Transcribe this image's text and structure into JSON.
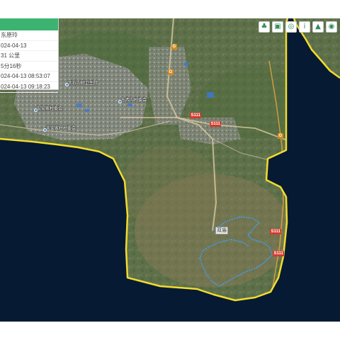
{
  "colors": {
    "background": "#071a33",
    "boundary": "#f2dc2e",
    "track": "#3fa0ff",
    "panel_header": "#3cb371",
    "road_red": "#d23b2c",
    "road_orange": "#d48a1e"
  },
  "info_panel": {
    "rows": [
      "东原玲",
      "024-04-13",
      "31 公里",
      "5分16秒",
      "024-04-13 08:53:07",
      "024-04-13 09:18:23"
    ]
  },
  "toolbar": {
    "buttons": [
      {
        "name": "tree-icon",
        "glyph": "♣"
      },
      {
        "name": "image-icon",
        "glyph": "▣"
      },
      {
        "name": "layers-icon",
        "glyph": "◎"
      },
      {
        "name": "info-icon",
        "glyph": "i"
      },
      {
        "name": "terrain-icon",
        "glyph": "▲"
      },
      {
        "name": "target-icon",
        "glyph": "◉"
      }
    ]
  },
  "map": {
    "road_labels": {
      "s111_1": "S111",
      "s111_2": "S111",
      "s111_3": "S111",
      "s111_4": "S111",
      "g1": "G",
      "g2": "G",
      "g3": "G"
    },
    "track_label": "双庙",
    "poi_labels": [
      "大石沟村卫生院",
      "东西沟村委会",
      "宏安家村委会",
      "天安家村村委会"
    ]
  }
}
